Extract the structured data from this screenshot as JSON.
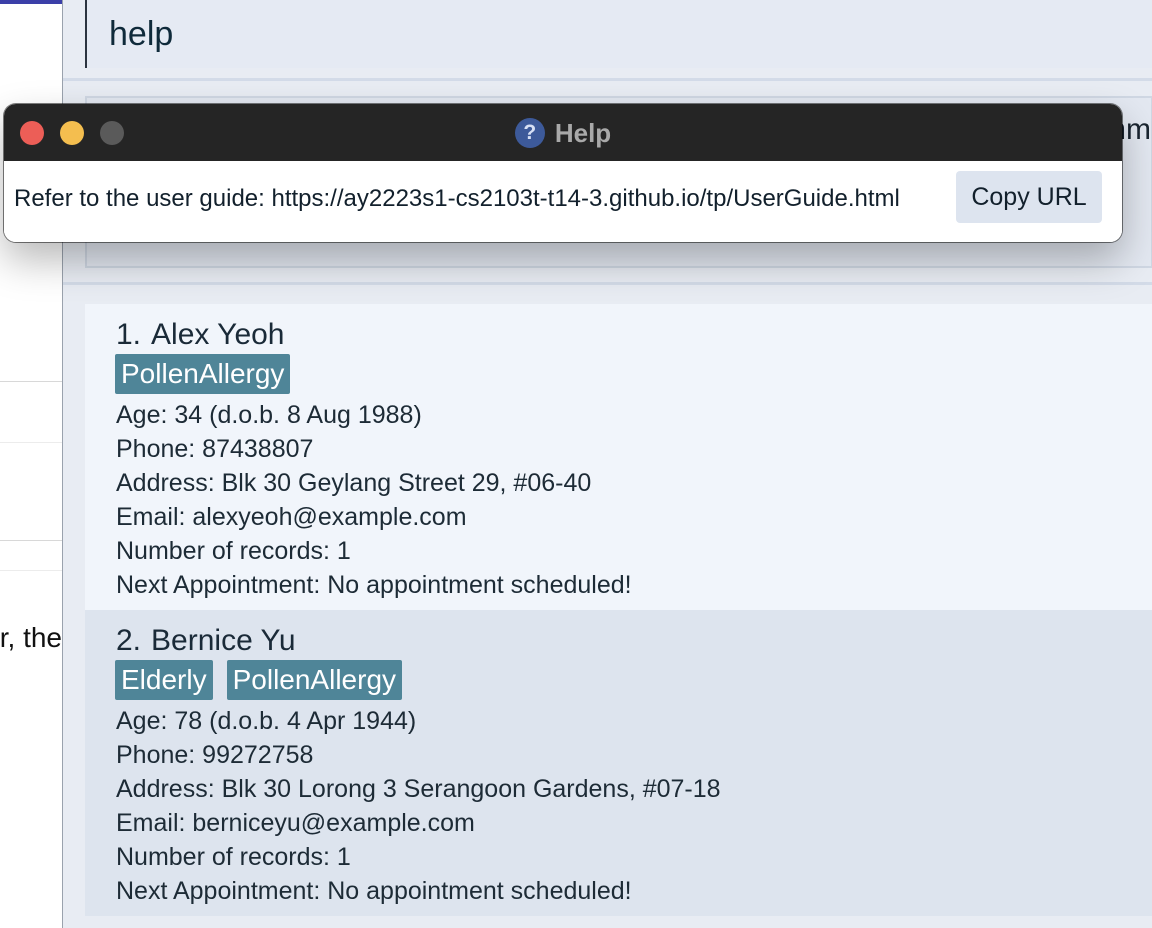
{
  "background_document": {
    "visible_text": "r, the"
  },
  "command": {
    "value": "help"
  },
  "result_display": {
    "clipped_text": "mm"
  },
  "persons": [
    {
      "index": "1.",
      "name": "Alex Yeoh",
      "tags": [
        "PollenAllergy"
      ],
      "age_line": "Age: 34   (d.o.b. 8 Aug 1988)",
      "phone_line": "Phone: 87438807",
      "address_line": "Address: Blk 30 Geylang Street 29, #06-40",
      "email_line": "Email: alexyeoh@example.com",
      "records_line": "Number of records: 1",
      "appointment_line": "Next Appointment: No appointment scheduled!"
    },
    {
      "index": "2.",
      "name": "Bernice Yu",
      "tags": [
        "Elderly",
        "PollenAllergy"
      ],
      "age_line": "Age: 78   (d.o.b. 4 Apr 1944)",
      "phone_line": "Phone: 99272758",
      "address_line": "Address: Blk 30 Lorong 3 Serangoon Gardens, #07-18",
      "email_line": "Email: berniceyu@example.com",
      "records_line": "Number of records: 1",
      "appointment_line": "Next Appointment: No appointment scheduled!"
    }
  ],
  "help_dialog": {
    "title": "Help",
    "icon": "help-question-icon",
    "message": "Refer to the user guide: https://ay2223s1-cs2103t-t14-3.github.io/tp/UserGuide.html",
    "copy_button_label": "Copy URL"
  },
  "colors": {
    "tag_background": "#4f8598",
    "titlebar": "#252525",
    "close_button": "#ec5e57",
    "minimize_button": "#f4be4f",
    "card_odd": "#f1f5fb",
    "card_even": "#dde4ee"
  }
}
